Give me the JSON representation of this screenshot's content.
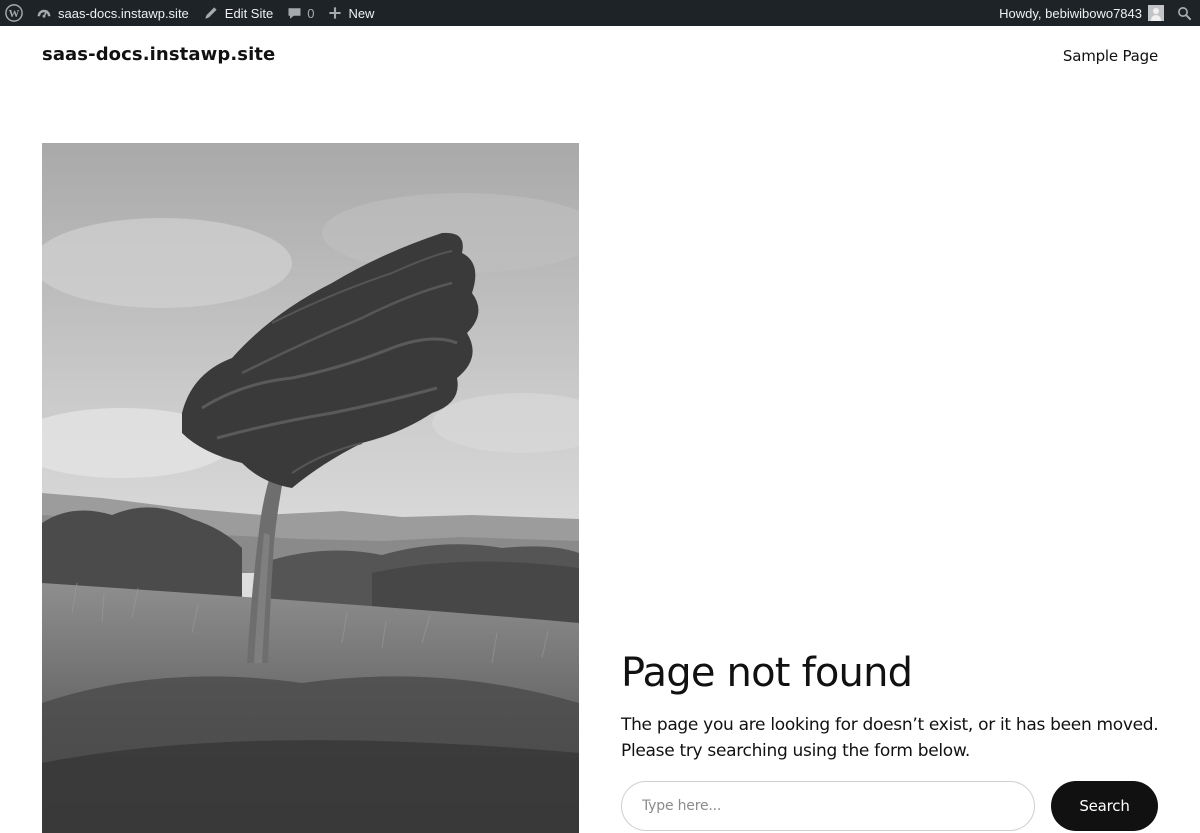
{
  "adminbar": {
    "site_name": "saas-docs.instawp.site",
    "edit_site": "Edit Site",
    "comments_count": "0",
    "new_label": "New",
    "greeting": "Howdy, bebiwibowo7843"
  },
  "header": {
    "site_title": "saas-docs.instawp.site",
    "nav_items": [
      "Sample Page"
    ]
  },
  "main": {
    "heading": "Page not found",
    "message": "The page you are looking for doesn’t exist, or it has been moved. Please try searching using the form below.",
    "search": {
      "placeholder": "Type here...",
      "value": "",
      "button_label": "Search"
    }
  },
  "colors": {
    "adminbar_bg": "#1d2327",
    "text": "#111111",
    "button_bg": "#111111",
    "page_bg": "#ffffff"
  },
  "icons": [
    "wordpress-icon",
    "dashboard-icon",
    "edit-icon",
    "comment-icon",
    "plus-icon",
    "search-icon"
  ]
}
